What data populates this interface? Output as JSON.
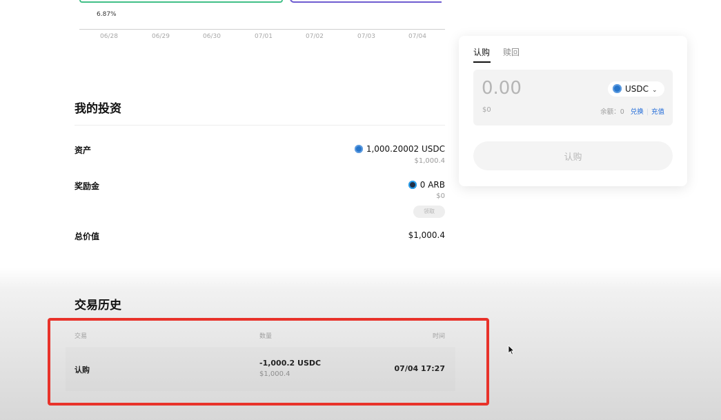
{
  "chart": {
    "percent_label": "6.87%",
    "x_ticks": [
      "06/28",
      "06/29",
      "06/30",
      "07/01",
      "07/02",
      "07/03",
      "07/04"
    ]
  },
  "investments": {
    "title": "我的投资",
    "assets_label": "资产",
    "assets_value": "1,000.20002 USDC",
    "assets_usd": "$1,000.4",
    "rewards_label": "奖励金",
    "rewards_value": "0 ARB",
    "rewards_usd": "$0",
    "claim_label": "领取",
    "total_label": "总价值",
    "total_value": "$1,000.4"
  },
  "history": {
    "title": "交易历史",
    "columns": [
      "交易",
      "数量",
      "时间"
    ],
    "rows": [
      {
        "type": "认购",
        "amount": "-1,000.2 USDC",
        "amount_usd": "$1,000.4",
        "time": "07/04 17:27"
      }
    ]
  },
  "subscribe_card": {
    "tabs": [
      "认购",
      "赎回"
    ],
    "active_tab": "认购",
    "amount": "0.00",
    "amount_usd": "$0",
    "token": "USDC",
    "balance_label": "余额：",
    "balance_value": "0",
    "exchange_link": "兑换",
    "deposit_link": "充值",
    "submit_label": "认购"
  },
  "colors": {
    "accent_link": "#1f6ad8",
    "highlight_border": "#e8322a",
    "series_green": "#3fbf86",
    "series_purple": "#6d5bd0"
  },
  "icons": [
    "usdc-icon",
    "arb-icon",
    "chevron-down-icon",
    "mouse-cursor-icon"
  ]
}
